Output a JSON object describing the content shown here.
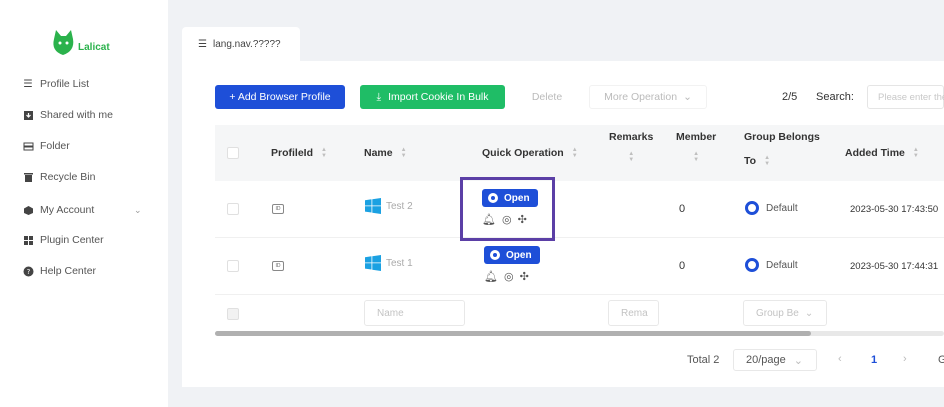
{
  "app": {
    "logo_text": "Lalicat",
    "brand_color": "#2bb24c",
    "accent_color": "#1e4fd8"
  },
  "sidebar": {
    "items": [
      {
        "label": "Profile List",
        "icon": "list-icon"
      },
      {
        "label": "Shared with me",
        "icon": "share-icon"
      },
      {
        "label": "Folder",
        "icon": "folder-icon"
      },
      {
        "label": "Recycle Bin",
        "icon": "trash-icon"
      },
      {
        "label": "My Account",
        "icon": "account-icon",
        "expandable": true
      },
      {
        "label": "Plugin Center",
        "icon": "grid-icon"
      },
      {
        "label": "Help Center",
        "icon": "help-icon"
      }
    ]
  },
  "tab": {
    "label": "lang.nav.?????"
  },
  "toolbar": {
    "add_profile": "+ Add Browser Profile",
    "import_cookie": "Import Cookie In Bulk",
    "delete": "Delete",
    "more_operation": "More Operation",
    "page_count": "2/5",
    "search_label": "Search:",
    "search_placeholder": "Please enter the"
  },
  "table": {
    "headers": {
      "profile_id": "ProfileId",
      "name": "Name",
      "quick_operation": "Quick Operation",
      "remarks": "Remarks",
      "member": "Member",
      "group_line1": "Group Belongs",
      "group_line2": "To",
      "added_time": "Added Time"
    },
    "open_label": "Open",
    "rows": [
      {
        "name": "Test 2",
        "member": "0",
        "group": "Default",
        "added_time": "2023-05-30 17:43:50"
      },
      {
        "name": "Test 1",
        "member": "0",
        "group": "Default",
        "added_time": "2023-05-30 17:44:31"
      }
    ],
    "filters": {
      "name_placeholder": "Name",
      "remarks_placeholder": "Rema",
      "group_placeholder": "Group Be"
    }
  },
  "footer": {
    "total": "Total 2",
    "page_size": "20/page",
    "current_page": "1",
    "next_extra": "G"
  }
}
